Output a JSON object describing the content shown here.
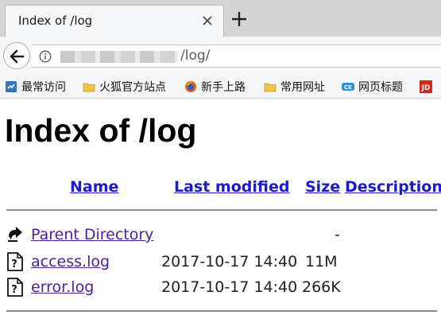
{
  "browser": {
    "tab_title": "Index of /log",
    "url_visible": "/log/"
  },
  "bookmarks": [
    {
      "label": "最常访问",
      "icon": "most-visited-icon"
    },
    {
      "label": "火狐官方站点",
      "icon": "folder-icon"
    },
    {
      "label": "新手上路",
      "icon": "firefox-icon"
    },
    {
      "label": "常用网址",
      "icon": "folder-icon"
    },
    {
      "label": "网页标题",
      "icon": "ce-icon"
    },
    {
      "label": "",
      "icon": "jd-icon"
    }
  ],
  "page": {
    "heading": "Index of /log",
    "columns": [
      "Name",
      "Last modified",
      "Size",
      "Description"
    ],
    "rows": [
      {
        "icon": "parent-directory-icon",
        "name": "Parent Directory",
        "modified": "",
        "size": "-",
        "description": ""
      },
      {
        "icon": "unknown-file-icon",
        "name": "access.log",
        "modified": "2017-10-17 14:40",
        "size": "11M",
        "description": ""
      },
      {
        "icon": "unknown-file-icon",
        "name": "error.log",
        "modified": "2017-10-17 14:40",
        "size": "266K",
        "description": ""
      }
    ]
  },
  "colors": {
    "header_link": "#1a1ad0",
    "visited_link": "#4b1fa0",
    "rule": "#8a8a8a"
  }
}
